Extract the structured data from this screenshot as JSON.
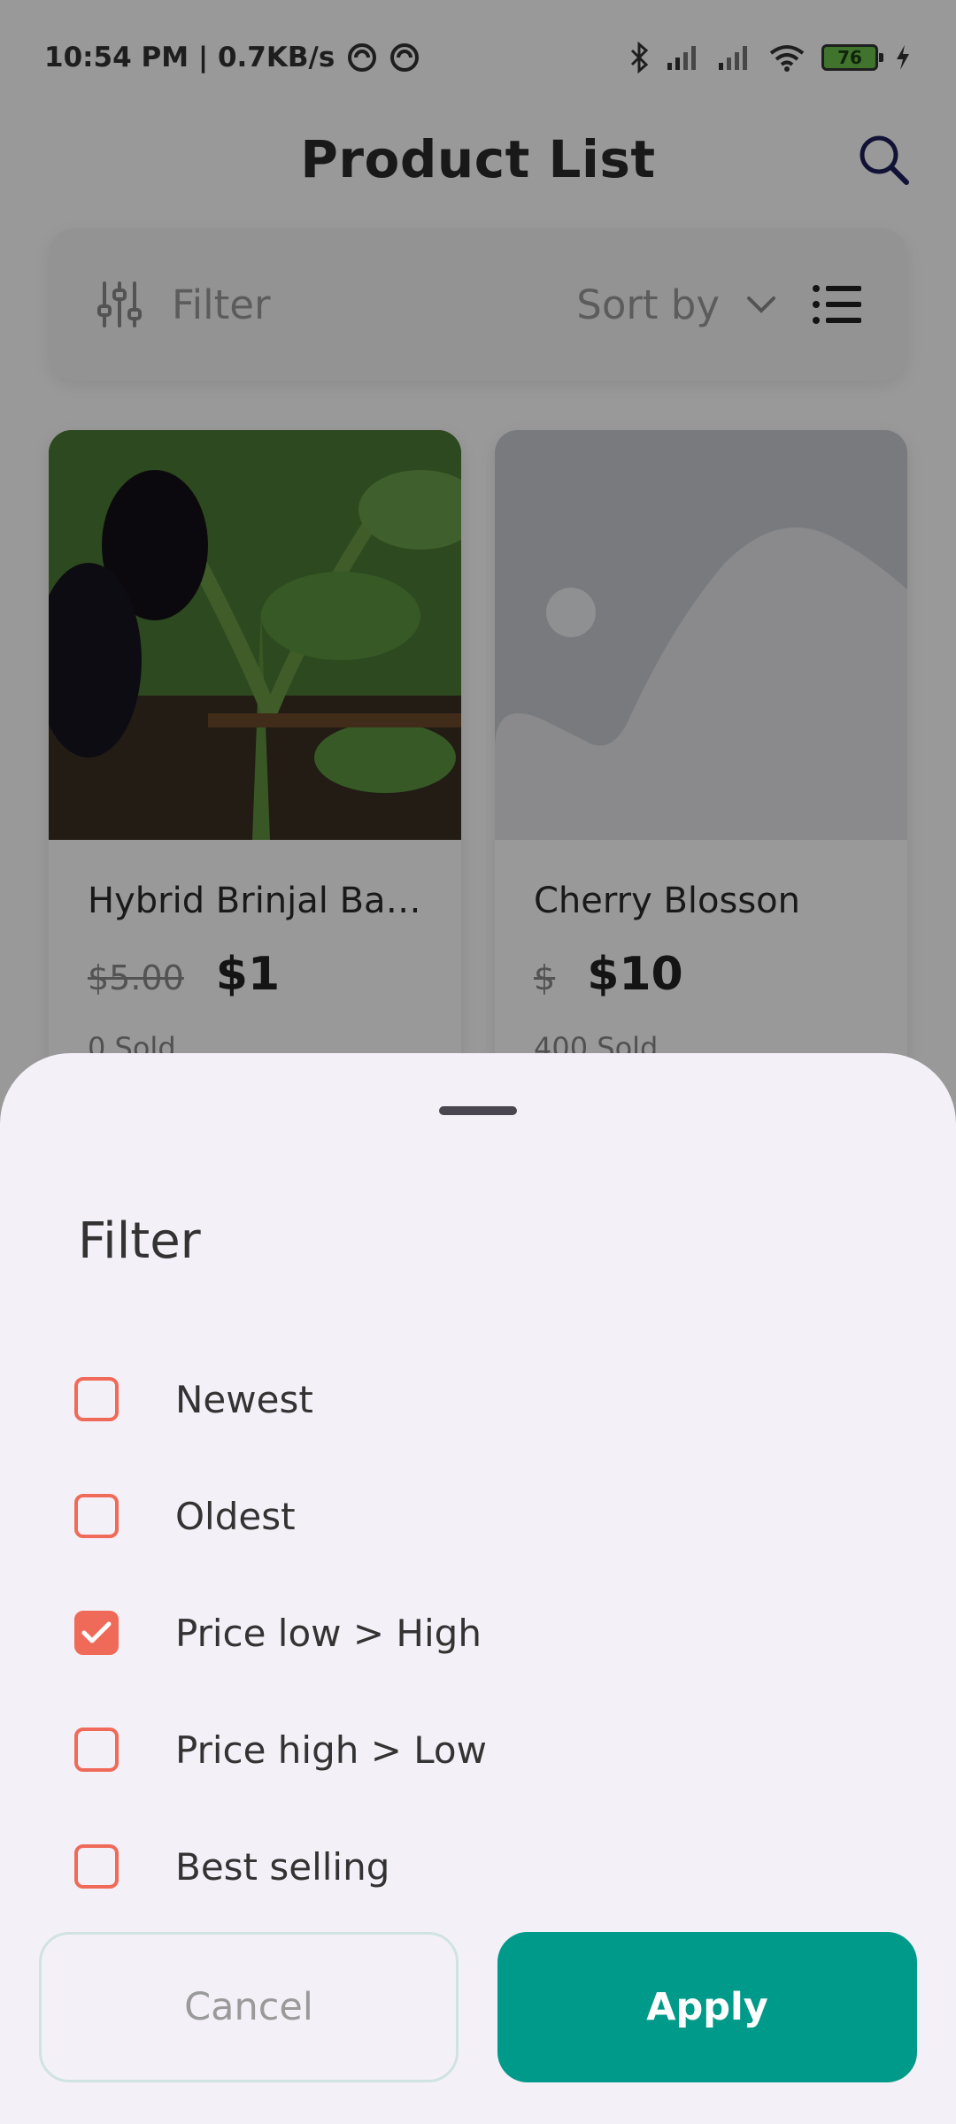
{
  "status_bar": {
    "time_network": "10:54 PM | 0.7KB/s",
    "battery_level": "76"
  },
  "header": {
    "title": "Product List"
  },
  "toolbar": {
    "filter_label": "Filter",
    "sort_label": "Sort by"
  },
  "products": [
    {
      "name": "Hybrid Brinjal Bari...",
      "old_price": "$5.00",
      "price": "$1",
      "sold": "0 Sold"
    },
    {
      "name": "Cherry Blosson",
      "old_price": "$",
      "price": "$10",
      "sold": "400 Sold"
    }
  ],
  "filter_sheet": {
    "title": "Filter",
    "options": [
      {
        "label": "Newest",
        "checked": false
      },
      {
        "label": "Oldest",
        "checked": false
      },
      {
        "label": "Price low > High",
        "checked": true
      },
      {
        "label": "Price high > Low",
        "checked": false
      },
      {
        "label": "Best selling",
        "checked": false
      }
    ],
    "cancel_label": "Cancel",
    "apply_label": "Apply"
  },
  "colors": {
    "accent_checkbox": "#f06a5a",
    "apply_button": "#009a8a",
    "sheet_background": "#f4f0f7"
  }
}
